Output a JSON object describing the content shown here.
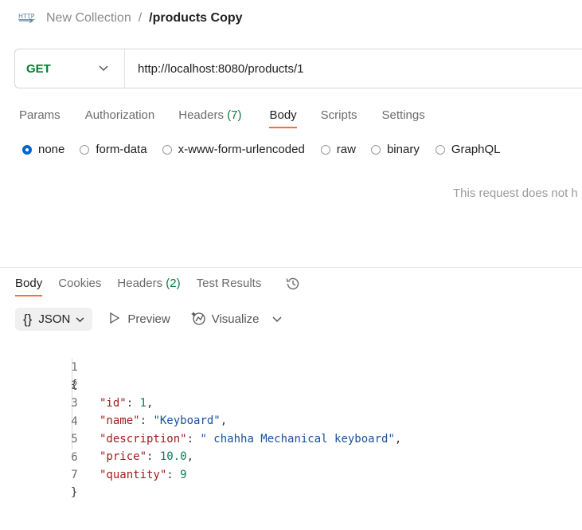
{
  "breadcrumb": {
    "collection": "New Collection",
    "separator": "/",
    "request_name": "/products Copy"
  },
  "request": {
    "method": "GET",
    "url": "http://localhost:8080/products/1"
  },
  "request_tabs": [
    {
      "label": "Params"
    },
    {
      "label": "Authorization"
    },
    {
      "label": "Headers",
      "count": "(7)"
    },
    {
      "label": "Body",
      "active": true
    },
    {
      "label": "Scripts"
    },
    {
      "label": "Settings"
    }
  ],
  "body_types": [
    {
      "label": "none",
      "selected": true
    },
    {
      "label": "form-data"
    },
    {
      "label": "x-www-form-urlencoded"
    },
    {
      "label": "raw"
    },
    {
      "label": "binary"
    },
    {
      "label": "GraphQL"
    }
  ],
  "no_body_message": "This request does not h",
  "response_tabs": [
    {
      "label": "Body",
      "active": true
    },
    {
      "label": "Cookies"
    },
    {
      "label": "Headers",
      "count": "(2)"
    },
    {
      "label": "Test Results"
    }
  ],
  "response_toolbar": {
    "format_icon": "{}",
    "format": "JSON",
    "preview": "Preview",
    "visualize": "Visualize"
  },
  "response_body": {
    "line_numbers": [
      "1",
      "2",
      "3",
      "4",
      "5",
      "6",
      "7"
    ],
    "open_brace": "{",
    "close_brace": "}",
    "fields": [
      {
        "key": "\"id\"",
        "value": "1",
        "type": "number",
        "trail": ","
      },
      {
        "key": "\"name\"",
        "value": "\"Keyboard\"",
        "type": "string",
        "trail": ","
      },
      {
        "key": "\"description\"",
        "value": "\" chahha Mechanical keyboard\"",
        "type": "string",
        "trail": ","
      },
      {
        "key": "\"price\"",
        "value": "10.0",
        "type": "number",
        "trail": ","
      },
      {
        "key": "\"quantity\"",
        "value": "9",
        "type": "number",
        "trail": ""
      }
    ]
  },
  "colors": {
    "accent_underline": "#ff6c37",
    "get_method": "#007f31",
    "radio_selected": "#0265d2",
    "json_key": "#a11b1b",
    "json_string": "#1a4f9c",
    "json_number": "#0c7a54"
  },
  "icons": [
    "http-request-icon",
    "chevron-down-icon",
    "play-icon",
    "visualize-icon",
    "history-icon"
  ]
}
